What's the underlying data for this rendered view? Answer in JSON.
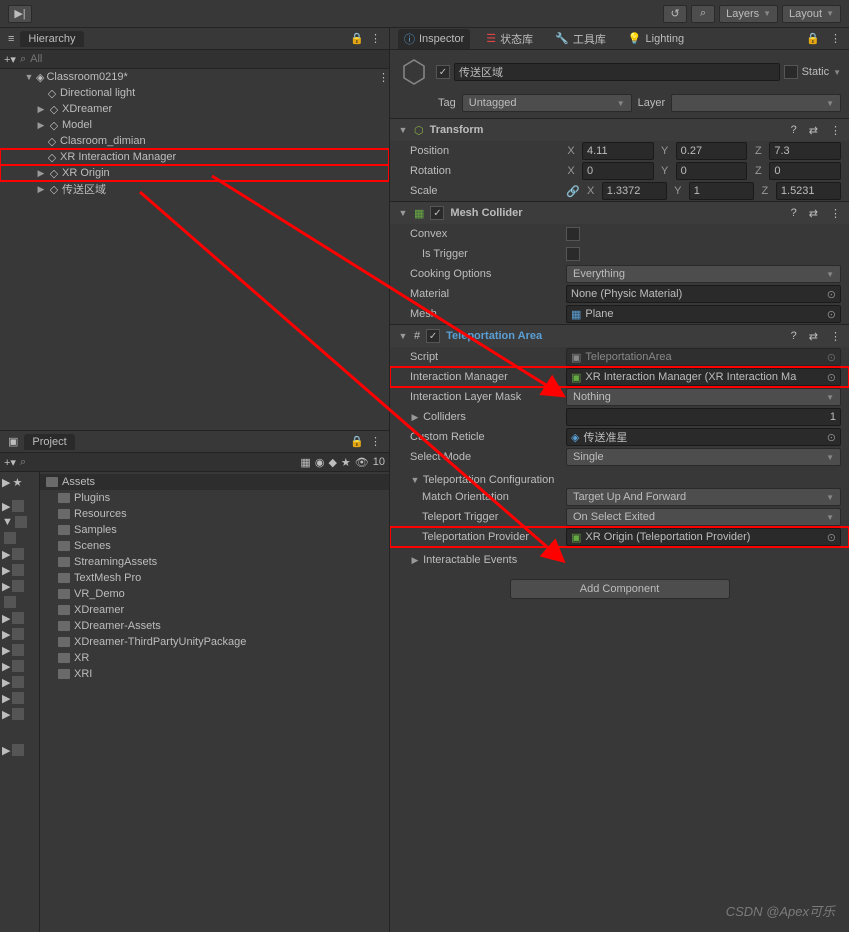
{
  "toolbar": {
    "layers": "Layers",
    "layout": "Layout"
  },
  "hierarchy": {
    "title": "Hierarchy",
    "search_placeholder": "All",
    "scene": "Classroom0219*",
    "items": [
      "Directional light",
      "XDreamer",
      "Model",
      "Clasroom_dimian",
      "XR Interaction Manager",
      "XR Origin",
      "传送区域"
    ]
  },
  "project": {
    "title": "Project",
    "assets_label": "Assets",
    "count": "10",
    "folders": [
      "Plugins",
      "Resources",
      "Samples",
      "Scenes",
      "StreamingAssets",
      "TextMesh Pro",
      "VR_Demo",
      "XDreamer",
      "XDreamer-Assets",
      "XDreamer-ThirdPartyUnityPackage",
      "XR",
      "XRI"
    ]
  },
  "inspector": {
    "tabs": {
      "inspector": "Inspector",
      "state": "状态库",
      "tools": "工具库",
      "lighting": "Lighting"
    },
    "obj_name": "传送区域",
    "static": "Static",
    "tag_label": "Tag",
    "tag_value": "Untagged",
    "layer_label": "Layer",
    "transform": {
      "title": "Transform",
      "pos": "Position",
      "rot": "Rotation",
      "scale": "Scale",
      "px": "4.11",
      "py": "0.27",
      "pz": "7.3",
      "rx": "0",
      "ry": "0",
      "rz": "0",
      "sx": "1.3372",
      "sy": "1",
      "sz": "1.5231"
    },
    "mesh": {
      "title": "Mesh Collider",
      "convex": "Convex",
      "trigger": "Is Trigger",
      "cooking": "Cooking Options",
      "cooking_val": "Everything",
      "material": "Material",
      "material_val": "None (Physic Material)",
      "mesh_label": "Mesh",
      "mesh_val": "Plane"
    },
    "teleport": {
      "title": "Teleportation Area",
      "script": "Script",
      "script_val": "TeleportationArea",
      "interaction_mgr": "Interaction Manager",
      "interaction_mgr_val": "XR Interaction Manager (XR Interaction Ma",
      "layer_mask": "Interaction Layer Mask",
      "layer_mask_val": "Nothing",
      "colliders": "Colliders",
      "colliders_count": "1",
      "reticle": "Custom Reticle",
      "reticle_val": "传送准星",
      "select_mode": "Select Mode",
      "select_mode_val": "Single",
      "config": "Teleportation Configuration",
      "match": "Match Orientation",
      "match_val": "Target Up And Forward",
      "trigger": "Teleport Trigger",
      "trigger_val": "On Select Exited",
      "provider": "Teleportation Provider",
      "provider_val": "XR Origin (Teleportation Provider)",
      "events": "Interactable Events"
    },
    "add_component": "Add Component"
  },
  "watermark": "CSDN @Apex可乐"
}
